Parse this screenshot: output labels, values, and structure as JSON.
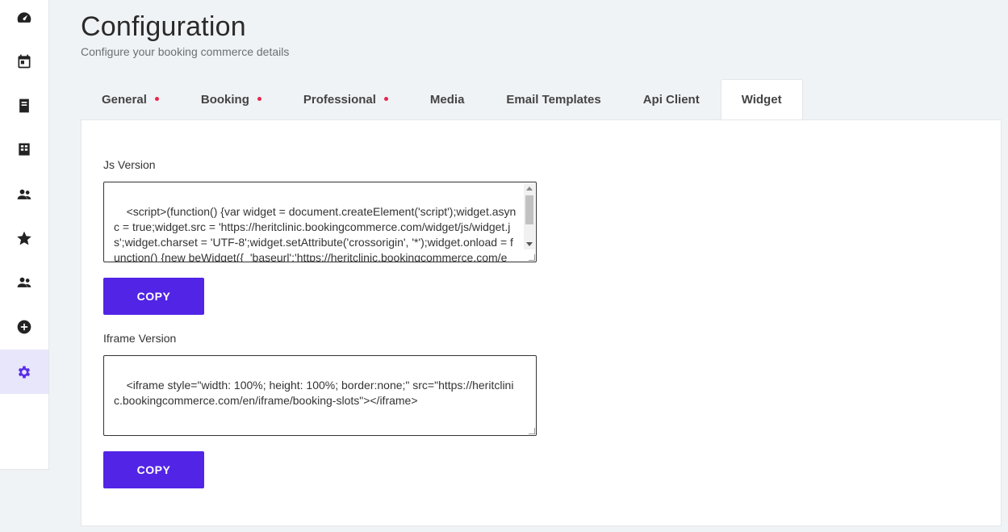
{
  "sidebar": {
    "items": [
      {
        "icon": "dashboard-icon"
      },
      {
        "icon": "calendar-icon"
      },
      {
        "icon": "document-icon"
      },
      {
        "icon": "grid-icon"
      },
      {
        "icon": "users-icon"
      },
      {
        "icon": "star-icon"
      },
      {
        "icon": "group-icon"
      },
      {
        "icon": "plus-circle-icon"
      },
      {
        "icon": "gear-icon",
        "active": true
      }
    ],
    "active_color": "#5a2ee8"
  },
  "header": {
    "title": "Configuration",
    "subtitle": "Configure your booking commerce details"
  },
  "tabs": [
    {
      "label": "General",
      "alert": true
    },
    {
      "label": "Booking",
      "alert": true
    },
    {
      "label": "Professional",
      "alert": true
    },
    {
      "label": "Media",
      "alert": false
    },
    {
      "label": "Email Templates",
      "alert": false
    },
    {
      "label": "Api Client",
      "alert": false
    },
    {
      "label": "Widget",
      "alert": false,
      "active": true
    }
  ],
  "widget": {
    "js_label": "Js Version",
    "js_code": "<script>(function() {var widget = document.createElement('script');widget.async = true;widget.src = 'https://heritclinic.bookingcommerce.com/widget/js/widget.js';widget.charset = 'UTF-8';widget.setAttribute('crossorigin', '*');widget.onload = function() {new beWidget({  'baseurl':'https://heritclinic.bookingcommerce.com/en',",
    "js_copy_label": "COPY",
    "iframe_label": "Iframe Version",
    "iframe_code": "<iframe style=\"width: 100%; height: 100%; border:none;\" src=\"https://heritclinic.bookingcommerce.com/en/iframe/booking-slots\"></iframe>",
    "iframe_copy_label": "COPY"
  },
  "colors": {
    "accent": "#5224e6",
    "alert_dot": "#e8264d"
  }
}
